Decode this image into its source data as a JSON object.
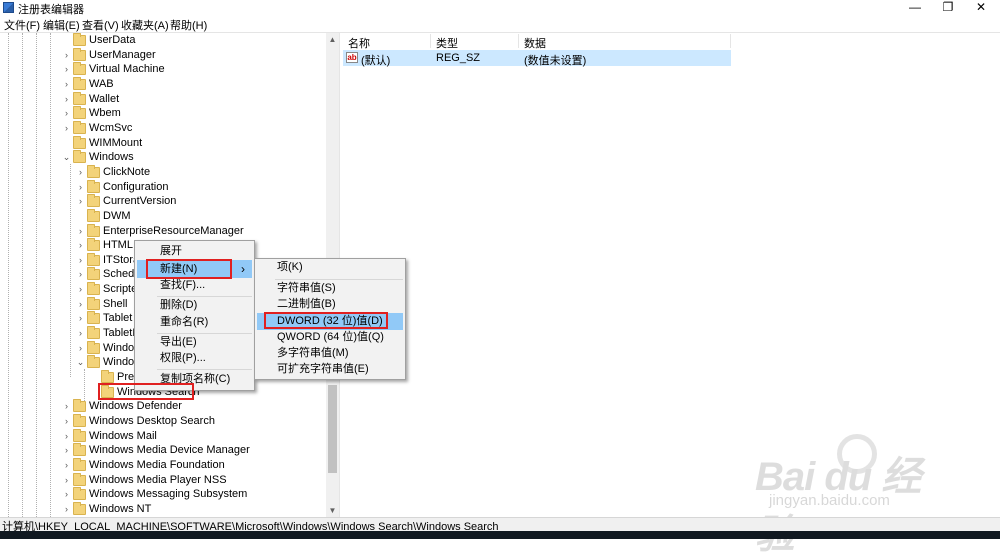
{
  "window": {
    "title": "注册表编辑器",
    "minimize_glyph": "—",
    "restore_glyph": "❐",
    "close_glyph": "✕"
  },
  "menubar": [
    "文件(F)",
    "编辑(E)",
    "查看(V)",
    "收藏夹(A)",
    "帮助(H)"
  ],
  "tree": {
    "items": [
      {
        "label": "UserData",
        "level": 1,
        "expander": ""
      },
      {
        "label": "UserManager",
        "level": 1,
        "expander": ">"
      },
      {
        "label": "Virtual Machine",
        "level": 1,
        "expander": ">"
      },
      {
        "label": "WAB",
        "level": 1,
        "expander": ">"
      },
      {
        "label": "Wallet",
        "level": 1,
        "expander": ">"
      },
      {
        "label": "Wbem",
        "level": 1,
        "expander": ">"
      },
      {
        "label": "WcmSvc",
        "level": 1,
        "expander": ">"
      },
      {
        "label": "WIMMount",
        "level": 1,
        "expander": ""
      },
      {
        "label": "Windows",
        "level": 1,
        "expander": "v"
      },
      {
        "label": "ClickNote",
        "level": 2,
        "expander": ">"
      },
      {
        "label": "Configuration",
        "level": 2,
        "expander": ">"
      },
      {
        "label": "CurrentVersion",
        "level": 2,
        "expander": ">"
      },
      {
        "label": "DWM",
        "level": 2,
        "expander": ""
      },
      {
        "label": "EnterpriseResourceManager",
        "level": 2,
        "expander": ">"
      },
      {
        "label": "HTML H",
        "level": 2,
        "expander": ">"
      },
      {
        "label": "ITStora",
        "level": 2,
        "expander": ">"
      },
      {
        "label": "Schedu",
        "level": 2,
        "expander": ">"
      },
      {
        "label": "Scripted",
        "level": 2,
        "expander": ">"
      },
      {
        "label": "Shell",
        "level": 2,
        "expander": ">"
      },
      {
        "label": "Tablet P",
        "level": 2,
        "expander": ">"
      },
      {
        "label": "TabletP",
        "level": 2,
        "expander": ">"
      },
      {
        "label": "Window",
        "level": 2,
        "expander": ">"
      },
      {
        "label": "Window",
        "level": 2,
        "expander": "v"
      },
      {
        "label": "Pref",
        "level": 3,
        "expander": ""
      },
      {
        "label": "Windows Search",
        "level": 3,
        "expander": ""
      },
      {
        "label": "Windows Defender",
        "level": 1,
        "expander": ">"
      },
      {
        "label": "Windows Desktop Search",
        "level": 1,
        "expander": ">"
      },
      {
        "label": "Windows Mail",
        "level": 1,
        "expander": ">"
      },
      {
        "label": "Windows Media Device Manager",
        "level": 1,
        "expander": ">"
      },
      {
        "label": "Windows Media Foundation",
        "level": 1,
        "expander": ">"
      },
      {
        "label": "Windows Media Player NSS",
        "level": 1,
        "expander": ">"
      },
      {
        "label": "Windows Messaging Subsystem",
        "level": 1,
        "expander": ">"
      },
      {
        "label": "Windows NT",
        "level": 1,
        "expander": ">"
      }
    ]
  },
  "list": {
    "columns": [
      "名称",
      "类型",
      "数据"
    ],
    "rows": [
      {
        "name": "(默认)",
        "type": "REG_SZ",
        "data": "(数值未设置)"
      }
    ]
  },
  "context_menu": {
    "items": [
      "展开",
      "新建(N)",
      "查找(F)...",
      "删除(D)",
      "重命名(R)",
      "导出(E)",
      "权限(P)...",
      "复制项名称(C)"
    ],
    "submenu_arrow": "›"
  },
  "submenu": {
    "items": [
      "项(K)",
      "字符串值(S)",
      "二进制值(B)",
      "DWORD (32 位)值(D)",
      "QWORD (64 位)值(Q)",
      "多字符串值(M)",
      "可扩充字符串值(E)"
    ]
  },
  "statusbar": {
    "path": "计算机\\HKEY_LOCAL_MACHINE\\SOFTWARE\\Microsoft\\Windows\\Windows Search\\Windows Search"
  },
  "watermark": {
    "brand": "Bai du 经验",
    "url": "jingyan.baidu.com"
  },
  "colors": {
    "selection": "#cce8ff",
    "menu_highlight": "#91c9f7",
    "annotation_red": "#e02020"
  }
}
